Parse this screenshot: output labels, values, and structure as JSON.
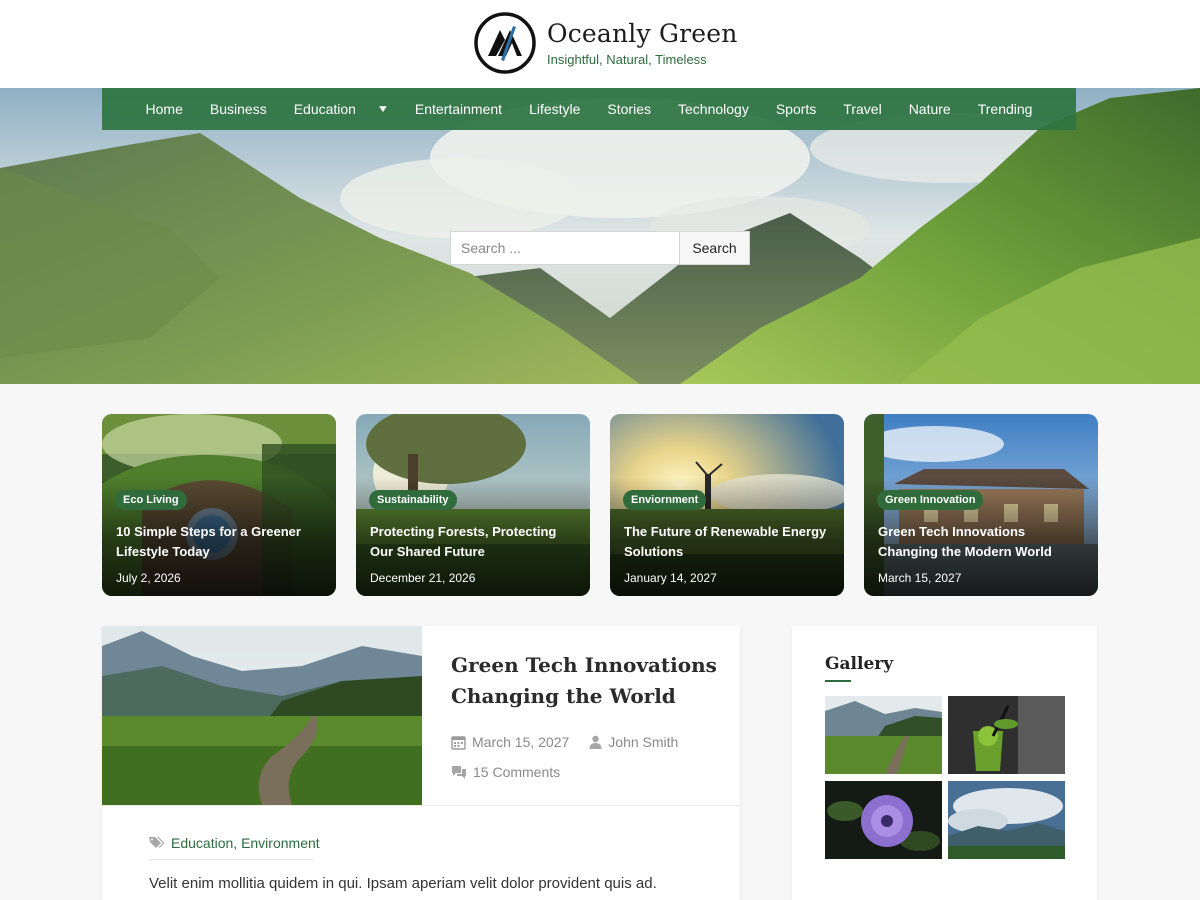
{
  "site": {
    "title": "Oceanly Green",
    "tagline": "Insightful, Natural, Timeless",
    "logo_icon": "triangle-monogram-icon"
  },
  "nav": {
    "items": [
      {
        "label": "Home"
      },
      {
        "label": "Business"
      },
      {
        "label": "Education",
        "has_dropdown": true
      },
      {
        "label": "Entertainment"
      },
      {
        "label": "Lifestyle"
      },
      {
        "label": "Stories"
      },
      {
        "label": "Technology"
      },
      {
        "label": "Sports"
      },
      {
        "label": "Travel"
      },
      {
        "label": "Nature"
      },
      {
        "label": "Trending"
      }
    ],
    "dropdown_icon": "chevron-down-icon"
  },
  "search": {
    "placeholder": "Search ...",
    "button_label": "Search"
  },
  "cards": [
    {
      "category": "Eco Living",
      "title": "10 Simple Steps for a Greener Lifestyle Today",
      "date": "July 2, 2026"
    },
    {
      "category": "Sustainability",
      "title": "Protecting Forests, Protecting Our Shared Future",
      "date": "December 21, 2026"
    },
    {
      "category": "Enviornment",
      "title": "The Future of Renewable Energy Solutions",
      "date": "January 14, 2027"
    },
    {
      "category": "Green Innovation",
      "title": "Green Tech Innovations Changing the Modern World",
      "date": "March 15, 2027"
    }
  ],
  "featured": {
    "title": "Green Tech Innovations Changing the World",
    "date": "March 15, 2027",
    "author": "John Smith",
    "comments": "15 Comments",
    "tags": [
      "Education",
      "Environment"
    ],
    "tag_separator": ",",
    "excerpt": "Velit enim mollitia quidem in qui. Ipsam aperiam velit dolor provident quis ad."
  },
  "gallery": {
    "title": "Gallery",
    "images": [
      "valley-path",
      "green-cocktail",
      "purple-flower",
      "mountain-clouds"
    ]
  },
  "colors": {
    "accent_green": "#2e6b3f",
    "nav_green": "#2e7442",
    "badge_green": "#2f6b3b"
  }
}
